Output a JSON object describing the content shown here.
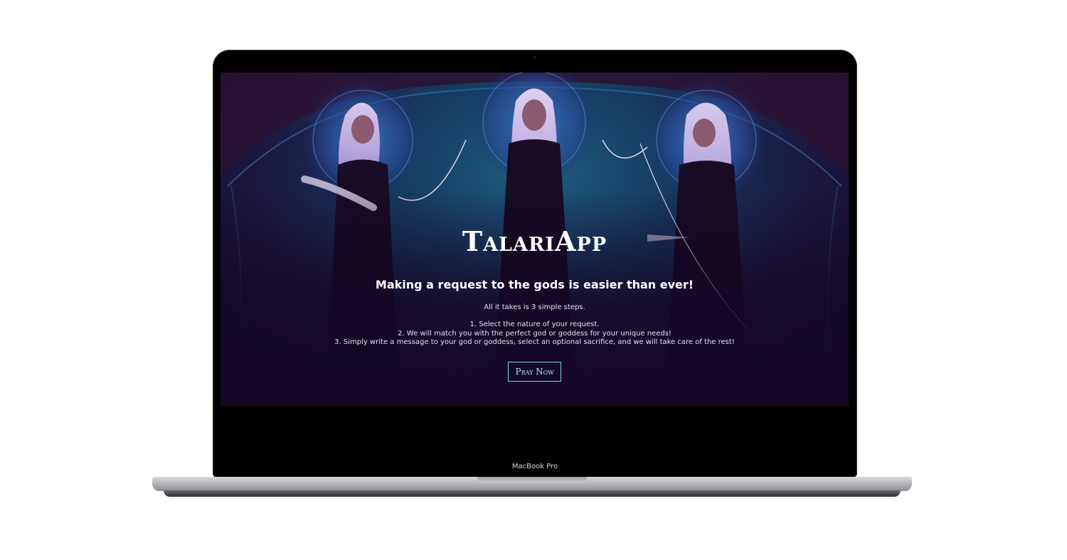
{
  "app": {
    "title": "TalariApp",
    "tagline": "Making a request to the gods is easier than ever!",
    "intro": "All it takes is 3 simple steps.",
    "steps": [
      "1. Select the nature of your request.",
      "2. We will match you with the perfect god or goddess for your unique needs!",
      "3. Simply write a message to your god or goddess, select an optional sacrifice, and we will take care of the rest!"
    ],
    "cta_label": "Pray Now"
  },
  "device": {
    "label": "MacBook Pro"
  },
  "colors": {
    "accent": "#7fd6d2",
    "background_top": "#1f5d7e",
    "background_bottom": "#150828"
  },
  "hero_image": {
    "icon": "three-goddesses-illustration"
  }
}
